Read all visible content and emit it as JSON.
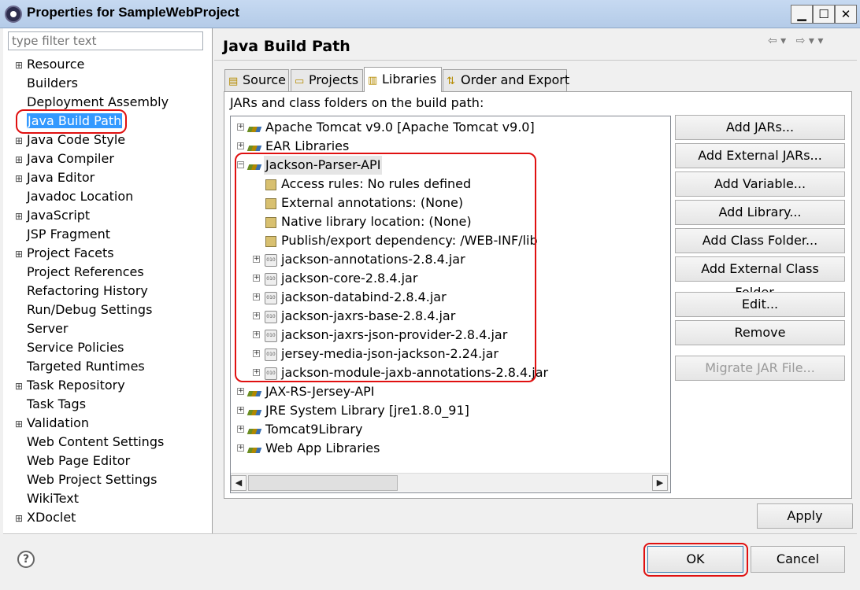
{
  "window": {
    "title": "Properties for SampleWebProject",
    "minimize": "▁",
    "maximize": "☐",
    "close": "✕"
  },
  "filter": {
    "placeholder": "type filter text"
  },
  "nav": {
    "items": [
      {
        "label": "Resource",
        "expandable": true
      },
      {
        "label": "Builders",
        "expandable": false
      },
      {
        "label": "Deployment Assembly",
        "expandable": false
      },
      {
        "label": "Java Build Path",
        "expandable": false,
        "selected": true
      },
      {
        "label": "Java Code Style",
        "expandable": true
      },
      {
        "label": "Java Compiler",
        "expandable": true
      },
      {
        "label": "Java Editor",
        "expandable": true
      },
      {
        "label": "Javadoc Location",
        "expandable": false
      },
      {
        "label": "JavaScript",
        "expandable": true
      },
      {
        "label": "JSP Fragment",
        "expandable": false
      },
      {
        "label": "Project Facets",
        "expandable": true
      },
      {
        "label": "Project References",
        "expandable": false
      },
      {
        "label": "Refactoring History",
        "expandable": false
      },
      {
        "label": "Run/Debug Settings",
        "expandable": false
      },
      {
        "label": "Server",
        "expandable": false
      },
      {
        "label": "Service Policies",
        "expandable": false
      },
      {
        "label": "Targeted Runtimes",
        "expandable": false
      },
      {
        "label": "Task Repository",
        "expandable": true
      },
      {
        "label": "Task Tags",
        "expandable": false
      },
      {
        "label": "Validation",
        "expandable": true
      },
      {
        "label": "Web Content Settings",
        "expandable": false
      },
      {
        "label": "Web Page Editor",
        "expandable": false
      },
      {
        "label": "Web Project Settings",
        "expandable": false
      },
      {
        "label": "WikiText",
        "expandable": false
      },
      {
        "label": "XDoclet",
        "expandable": true
      }
    ]
  },
  "page": {
    "title": "Java Build Path",
    "section_label": "JARs and class folders on the build path:"
  },
  "tabs": [
    {
      "label": "Source",
      "icon": "source-icon"
    },
    {
      "label": "Projects",
      "icon": "projects-icon"
    },
    {
      "label": "Libraries",
      "icon": "libraries-icon",
      "active": true
    },
    {
      "label": "Order and Export",
      "icon": "order-export-icon"
    }
  ],
  "tree": [
    {
      "label": "Apache Tomcat v9.0 [Apache Tomcat v9.0]",
      "icon": "library-icon",
      "expander": "+"
    },
    {
      "label": "EAR Libraries",
      "icon": "library-icon",
      "expander": "+"
    },
    {
      "label": "Jackson-Parser-API",
      "icon": "library-icon",
      "expander": "−",
      "selected": true
    },
    {
      "label": "Access rules: No rules defined",
      "icon": "access-rules-icon",
      "expander": ""
    },
    {
      "label": "External annotations: (None)",
      "icon": "annotations-icon",
      "expander": ""
    },
    {
      "label": "Native library location: (None)",
      "icon": "native-library-icon",
      "expander": ""
    },
    {
      "label": "Publish/export dependency: /WEB-INF/lib",
      "icon": "publish-icon",
      "expander": ""
    },
    {
      "label": "jackson-annotations-2.8.4.jar",
      "icon": "jar-icon",
      "expander": "+"
    },
    {
      "label": "jackson-core-2.8.4.jar",
      "icon": "jar-icon",
      "expander": "+"
    },
    {
      "label": "jackson-databind-2.8.4.jar",
      "icon": "jar-icon",
      "expander": "+"
    },
    {
      "label": "jackson-jaxrs-base-2.8.4.jar",
      "icon": "jar-icon",
      "expander": "+"
    },
    {
      "label": "jackson-jaxrs-json-provider-2.8.4.jar",
      "icon": "jar-icon",
      "expander": "+"
    },
    {
      "label": "jersey-media-json-jackson-2.24.jar",
      "icon": "jar-icon",
      "expander": "+"
    },
    {
      "label": "jackson-module-jaxb-annotations-2.8.4.jar",
      "icon": "jar-icon",
      "expander": "+"
    },
    {
      "label": "JAX-RS-Jersey-API",
      "icon": "library-icon",
      "expander": "+"
    },
    {
      "label": "JRE System Library [jre1.8.0_91]",
      "icon": "library-icon",
      "expander": "+"
    },
    {
      "label": "Tomcat9Library",
      "icon": "library-icon",
      "expander": "+"
    },
    {
      "label": "Web App Libraries",
      "icon": "library-icon",
      "expander": "+"
    }
  ],
  "buttons": {
    "add_jars": "Add JARs...",
    "add_external_jars": "Add External JARs...",
    "add_variable": "Add Variable...",
    "add_library": "Add Library...",
    "add_class_folder": "Add Class Folder...",
    "add_external_class_folder": "Add External Class Folder...",
    "edit": "Edit...",
    "remove": "Remove",
    "migrate_jar": "Migrate JAR File...",
    "apply": "Apply",
    "ok": "OK",
    "cancel": "Cancel"
  },
  "scroll": {
    "left_arrow": "◀",
    "right_arrow": "▶"
  },
  "history": {
    "back": "⇦ ▾",
    "forward": "⇨ ▾ ▾"
  },
  "help": {
    "glyph": "?"
  },
  "colors": {
    "selection": "#3399ff",
    "highlight_annotation": "#e01010"
  }
}
